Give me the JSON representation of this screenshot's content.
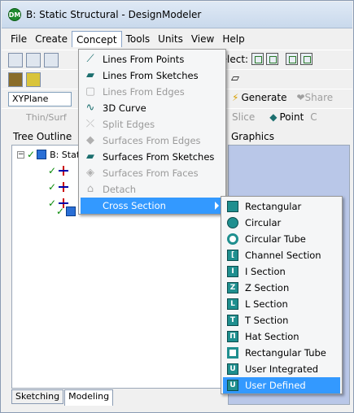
{
  "window": {
    "title": "B: Static Structural - DesignModeler",
    "app_icon_text": "DM"
  },
  "menubar": {
    "items": [
      "File",
      "Create",
      "Concept",
      "Tools",
      "Units",
      "View",
      "Help"
    ],
    "active": "Concept"
  },
  "toolbar": {
    "select_label": "Select:",
    "plane_value": "XYPlane",
    "generate_label": "Generate",
    "share_label": "Share",
    "thin_surface_label": "Thin/Surf",
    "slice_label": "Slice",
    "point_label": "Point",
    "extra_label": "C"
  },
  "panels": {
    "tree_outline_title": "Tree Outline",
    "graphics_title": "Graphics",
    "tree_root_label": "B: Stat"
  },
  "tabs": {
    "sketching": "Sketching",
    "modeling": "Modeling"
  },
  "concept_menu": {
    "items": [
      {
        "label": "Lines From Points",
        "icon": "line-points-icon",
        "enabled": true
      },
      {
        "label": "Lines From Sketches",
        "icon": "line-sketch-icon",
        "enabled": true
      },
      {
        "label": "Lines From Edges",
        "icon": "line-edges-icon",
        "enabled": false
      },
      {
        "label": "3D Curve",
        "icon": "curve-icon",
        "enabled": true
      },
      {
        "label": "Split Edges",
        "icon": "split-edges-icon",
        "enabled": false
      },
      {
        "label": "Surfaces From Edges",
        "icon": "surface-edges-icon",
        "enabled": false
      },
      {
        "label": "Surfaces From Sketches",
        "icon": "surface-sketch-icon",
        "enabled": true
      },
      {
        "label": "Surfaces From Faces",
        "icon": "surface-faces-icon",
        "enabled": false
      },
      {
        "label": "Detach",
        "icon": "detach-icon",
        "enabled": false
      },
      {
        "label": "Cross Section",
        "icon": "",
        "enabled": true,
        "highlighted": true,
        "submenu": true
      }
    ]
  },
  "cross_section_menu": {
    "items": [
      {
        "label": "Rectangular",
        "icon": "rectangular-icon"
      },
      {
        "label": "Circular",
        "icon": "circular-icon"
      },
      {
        "label": "Circular Tube",
        "icon": "circular-tube-icon"
      },
      {
        "label": "Channel Section",
        "icon": "channel-section-icon",
        "glyph": "["
      },
      {
        "label": "I Section",
        "icon": "i-section-icon",
        "glyph": "I"
      },
      {
        "label": "Z Section",
        "icon": "z-section-icon",
        "glyph": "Z"
      },
      {
        "label": "L Section",
        "icon": "l-section-icon",
        "glyph": "L"
      },
      {
        "label": "T Section",
        "icon": "t-section-icon",
        "glyph": "T"
      },
      {
        "label": "Hat Section",
        "icon": "hat-section-icon",
        "glyph": "Π"
      },
      {
        "label": "Rectangular Tube",
        "icon": "rectangular-tube-icon"
      },
      {
        "label": "User Integrated",
        "icon": "user-integrated-icon",
        "glyph": "U"
      },
      {
        "label": "User Defined",
        "icon": "user-defined-icon",
        "glyph": "U",
        "highlighted": true
      }
    ]
  },
  "colors": {
    "highlight": "#3399ff",
    "graphics_bg": "#b9c7e8",
    "section_icon": "#1f8f8f"
  }
}
